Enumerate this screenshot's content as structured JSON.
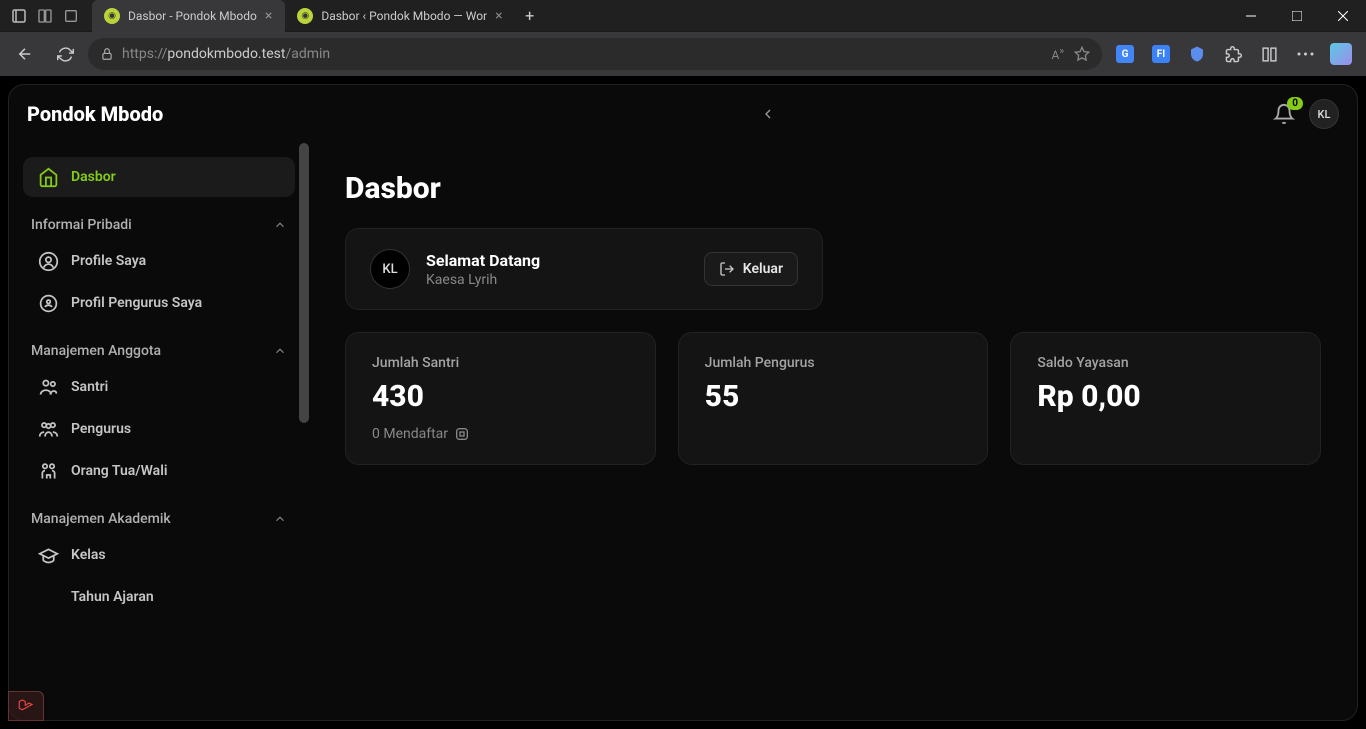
{
  "browser": {
    "tabs": [
      {
        "title": "Dasbor - Pondok Mbodo",
        "active": true
      },
      {
        "title": "Dasbor ‹ Pondok Mbodo — Wor",
        "active": false
      }
    ],
    "url_prefix": "https://",
    "url_host": "pondokmbodo.test",
    "url_path": "/admin"
  },
  "header": {
    "brand": "Pondok Mbodo",
    "notif_count": "0",
    "avatar_initials": "KL"
  },
  "sidebar": {
    "dashboard": "Dasbor",
    "sections": [
      {
        "label": "Informai Pribadi",
        "items": [
          "Profile Saya",
          "Profil Pengurus Saya"
        ]
      },
      {
        "label": "Manajemen Anggota",
        "items": [
          "Santri",
          "Pengurus",
          "Orang Tua/Wali"
        ]
      },
      {
        "label": "Manajemen Akademik",
        "items": [
          "Kelas",
          "Tahun Ajaran"
        ]
      }
    ]
  },
  "main": {
    "title": "Dasbor",
    "welcome_title": "Selamat Datang",
    "welcome_user": "Kaesa Lyrih",
    "welcome_avatar": "KL",
    "logout_label": "Keluar",
    "stats": [
      {
        "label": "Jumlah Santri",
        "value": "430",
        "desc": "0 Mendaftar"
      },
      {
        "label": "Jumlah Pengurus",
        "value": "55",
        "desc": ""
      },
      {
        "label": "Saldo Yayasan",
        "value": "Rp 0,00",
        "desc": ""
      }
    ]
  }
}
